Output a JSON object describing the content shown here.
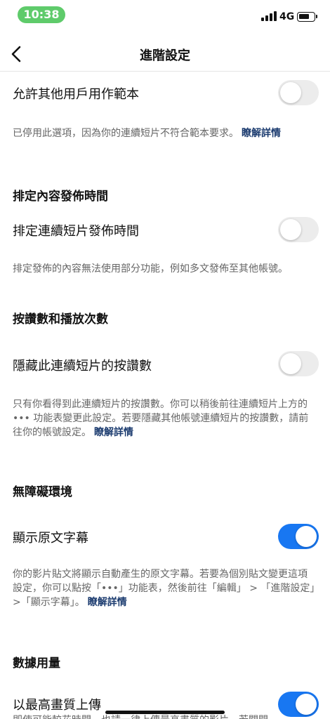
{
  "status_bar": {
    "time": "10:38",
    "network": "4G"
  },
  "nav": {
    "title": "進階設定"
  },
  "settings": {
    "template": {
      "label": "允許其他用戶用作範本",
      "enabled": false,
      "description": "已停用此選項，因為你的連續短片不符合範本要求。",
      "link": "瞭解詳情"
    },
    "schedule_section": "排定內容發佈時間",
    "schedule": {
      "label": "排定連續短片發佈時間",
      "enabled": false,
      "description": "排定發佈的內容無法使用部分功能，例如多文發佈至其他帳號。"
    },
    "likes_section": "按讚數和播放次數",
    "hide_likes": {
      "label": "隱藏此連續短片的按讚數",
      "enabled": false,
      "description": "只有你看得到此連續短片的按讚數。你可以稍後前往連續短片上方的 ••• 功能表變更此設定。若要隱藏其他帳號連續短片的按讚數，請前往你的帳號設定。",
      "link": "瞭解詳情"
    },
    "accessibility_section": "無障礙環境",
    "captions": {
      "label": "顯示原文字幕",
      "enabled": true,
      "description": "你的影片貼文將顯示自動產生的原文字幕。若要為個別貼文變更這項設定，你可以點按「•••」功能表，然後前往「編輯」 > 「進階設定」>「顯示字幕」。",
      "link": "瞭解詳情"
    },
    "data_section": "數據用量",
    "high_quality": {
      "label": "以最高畫質上傳",
      "enabled": true,
      "description": "即使可能較花時間，也請一律上傳最高畫質的影片。若關閉"
    }
  },
  "colors": {
    "toggle_on": "#1877f2",
    "link": "#1b3b6f",
    "time_pill": "#5fcb6b"
  }
}
